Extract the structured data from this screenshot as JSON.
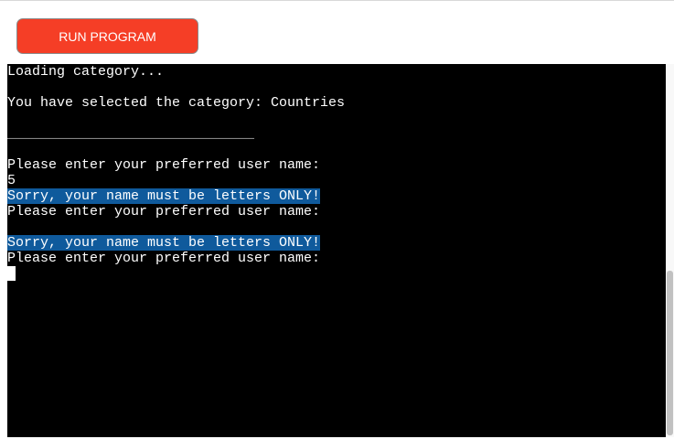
{
  "toolbar": {
    "run_label": "RUN PROGRAM",
    "run_color": "#f53e26"
  },
  "terminal": {
    "lines": [
      {
        "text": "Loading category...",
        "highlight": false
      },
      {
        "text": "",
        "highlight": false
      },
      {
        "text": "You have selected the category: Countries",
        "highlight": false
      },
      {
        "text": "",
        "highlight": false
      },
      {
        "text": "______________________________",
        "highlight": false
      },
      {
        "text": "",
        "highlight": false
      },
      {
        "text": "Please enter your preferred user name:",
        "highlight": false
      },
      {
        "text": "5",
        "highlight": false
      },
      {
        "text": "Sorry, your name must be letters ONLY!",
        "highlight": true
      },
      {
        "text": "Please enter your preferred user name:",
        "highlight": false
      },
      {
        "text": "",
        "highlight": false
      },
      {
        "text": "Sorry, your name must be letters ONLY!",
        "highlight": true
      },
      {
        "text": "Please enter your preferred user name:",
        "highlight": false
      }
    ],
    "highlight_color": "#0f5a9c"
  }
}
